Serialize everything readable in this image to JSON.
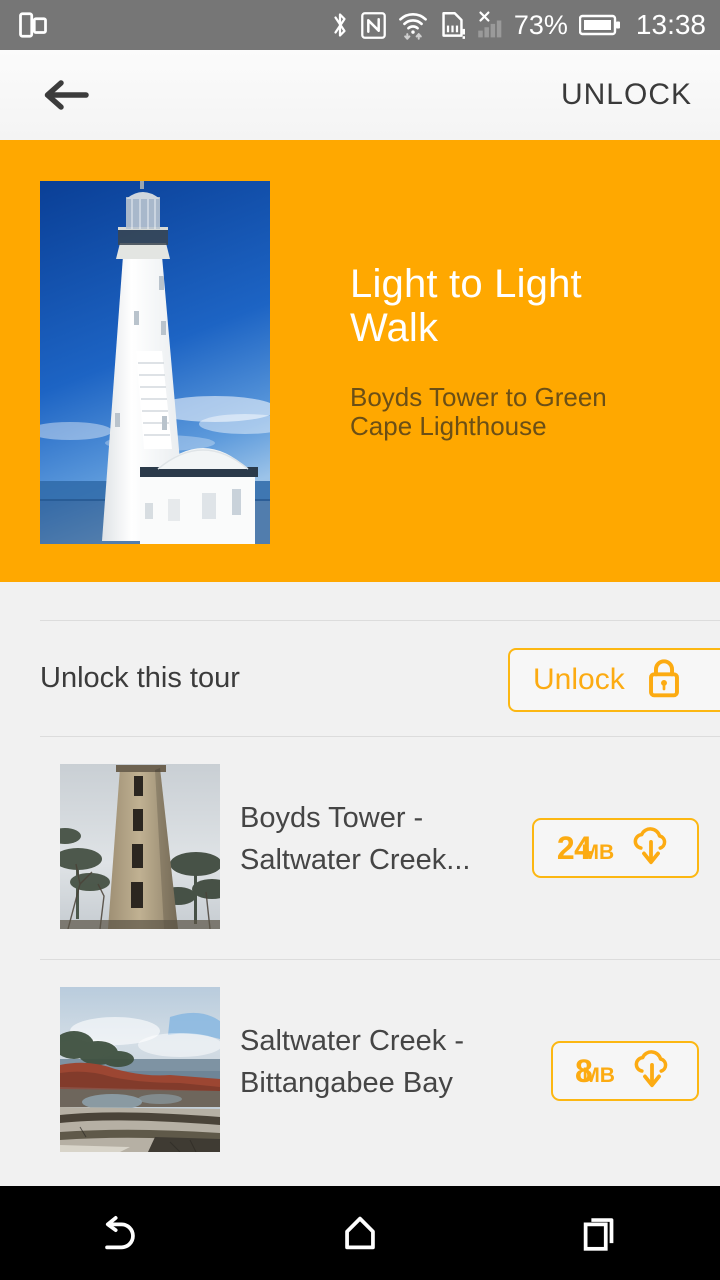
{
  "status_bar": {
    "left_icon": "multi-window-icon",
    "icons": [
      "bluetooth-icon",
      "nfc-icon",
      "wifi-icon",
      "sim-card-alert-icon",
      "cellular-signal-off-icon"
    ],
    "battery_percent": "73%",
    "battery_icon": "battery-icon",
    "clock": "13:38"
  },
  "app_bar": {
    "back_icon": "back-arrow-icon",
    "action_label": "UNLOCK"
  },
  "hero": {
    "background_color": "#ffa800",
    "image": "lighthouse-photo",
    "title": "Light to Light\nWalk",
    "subtitle": "Boyds Tower to Green\nCape Lighthouse",
    "title_color": "#ffffff",
    "subtitle_color": "#6b4f16"
  },
  "unlock_section": {
    "label": "Unlock this tour",
    "button_label": "Unlock",
    "button_icon": "lock-icon",
    "accent_color": "#fcab12"
  },
  "tours": [
    {
      "title": "Boyds Tower -\nSaltwater Creek...",
      "thumbnail": "boyds-tower-photo",
      "size_number": "24",
      "size_unit": "MB",
      "download_icon": "cloud-download-icon"
    },
    {
      "title": "Saltwater Creek -\nBittangabee Bay",
      "thumbnail": "bittangabee-bay-photo",
      "size_number": "8",
      "size_unit": "MB",
      "download_icon": "cloud-download-icon"
    }
  ],
  "nav_bar": {
    "back": "back-nav-icon",
    "home": "home-nav-icon",
    "recents": "recents-nav-icon"
  }
}
